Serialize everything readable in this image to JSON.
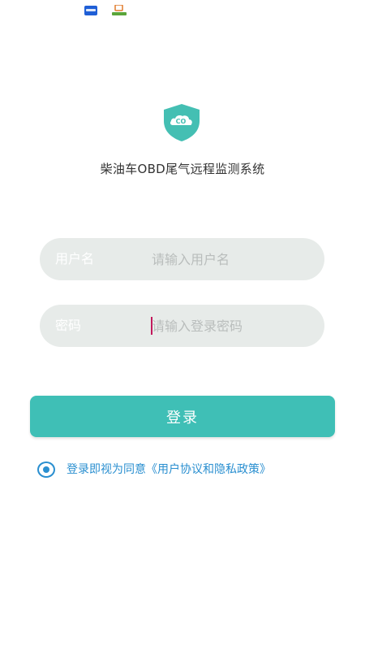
{
  "status_bar": {
    "icons": [
      "app-notification-icon",
      "app-notification-icon-2"
    ]
  },
  "header": {
    "logo_text": "CO",
    "title": "柴油车OBD尾气远程监测系统"
  },
  "form": {
    "username": {
      "label": "用户名",
      "value": "",
      "placeholder": "请输入用户名"
    },
    "password": {
      "label": "密码",
      "value": "",
      "placeholder": "请输入登录密码"
    },
    "login_label": "登录",
    "agreement": {
      "checked": true,
      "text": "登录即视为同意《用户协议和隐私政策》"
    }
  },
  "colors": {
    "accent": "#3fbfb6",
    "link": "#2a8fd0",
    "field_bg": "#e7ebe9",
    "cursor": "#c2185b"
  }
}
